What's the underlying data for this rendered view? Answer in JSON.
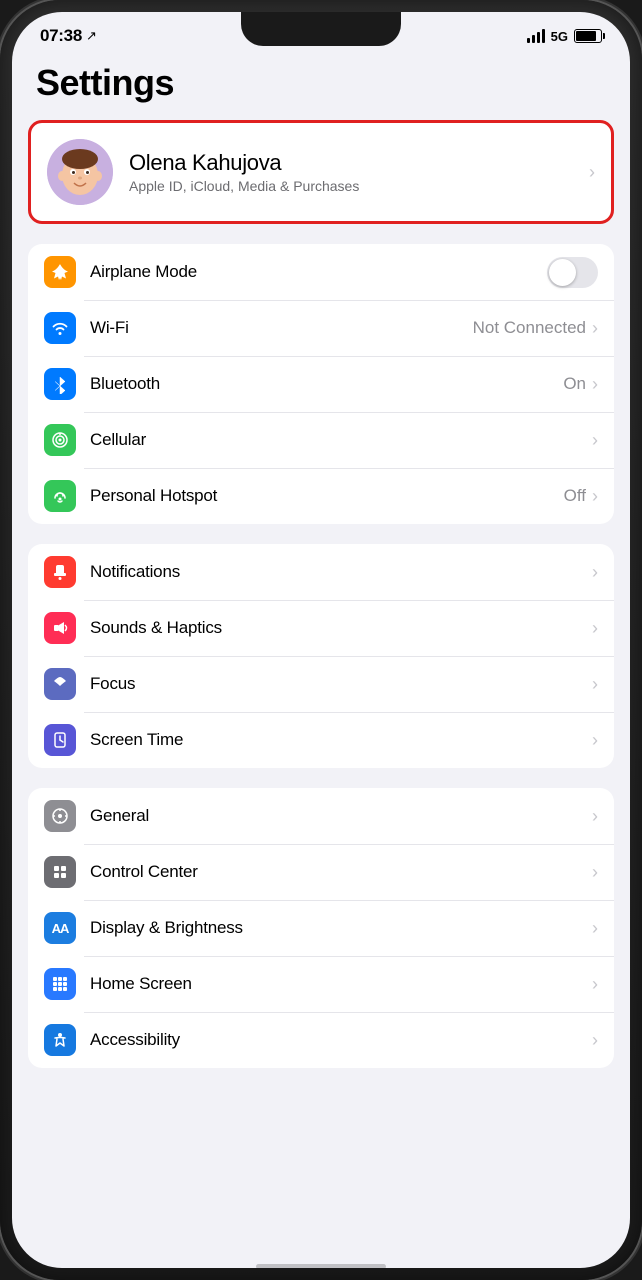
{
  "statusBar": {
    "time": "07:38",
    "signal5g": "5G"
  },
  "pageTitle": "Settings",
  "profile": {
    "name": "Olena Kahujova",
    "subtitle": "Apple ID, iCloud, Media & Purchases",
    "avatarEmoji": "🧑"
  },
  "groups": [
    {
      "id": "connectivity",
      "items": [
        {
          "id": "airplane-mode",
          "label": "Airplane Mode",
          "iconBg": "icon-orange",
          "iconEmoji": "✈",
          "type": "toggle",
          "toggleOn": false
        },
        {
          "id": "wifi",
          "label": "Wi-Fi",
          "iconBg": "icon-blue",
          "iconEmoji": "📶",
          "type": "value",
          "value": "Not Connected"
        },
        {
          "id": "bluetooth",
          "label": "Bluetooth",
          "iconBg": "icon-blue-dark",
          "iconEmoji": "🔷",
          "type": "value",
          "value": "On"
        },
        {
          "id": "cellular",
          "label": "Cellular",
          "iconBg": "icon-green",
          "iconEmoji": "📡",
          "type": "chevron"
        },
        {
          "id": "personal-hotspot",
          "label": "Personal Hotspot",
          "iconBg": "icon-green",
          "iconEmoji": "🔗",
          "type": "value",
          "value": "Off"
        }
      ]
    },
    {
      "id": "notifications",
      "items": [
        {
          "id": "notifications",
          "label": "Notifications",
          "iconBg": "icon-red",
          "iconEmoji": "🔔",
          "type": "chevron"
        },
        {
          "id": "sounds-haptics",
          "label": "Sounds & Haptics",
          "iconBg": "icon-pink",
          "iconEmoji": "🔊",
          "type": "chevron"
        },
        {
          "id": "focus",
          "label": "Focus",
          "iconBg": "icon-indigo",
          "iconEmoji": "🌙",
          "type": "chevron"
        },
        {
          "id": "screen-time",
          "label": "Screen Time",
          "iconBg": "icon-purple",
          "iconEmoji": "⌛",
          "type": "chevron"
        }
      ]
    },
    {
      "id": "display",
      "items": [
        {
          "id": "general",
          "label": "General",
          "iconBg": "icon-gray",
          "iconEmoji": "⚙",
          "type": "chevron"
        },
        {
          "id": "control-center",
          "label": "Control Center",
          "iconBg": "icon-gray2",
          "iconEmoji": "⊞",
          "type": "chevron"
        },
        {
          "id": "display-brightness",
          "label": "Display & Brightness",
          "iconBg": "icon-aa-blue",
          "iconEmoji": "AA",
          "type": "chevron"
        },
        {
          "id": "home-screen",
          "label": "Home Screen",
          "iconBg": "icon-homescreen",
          "iconEmoji": "⊞",
          "type": "chevron"
        },
        {
          "id": "accessibility",
          "label": "Accessibility",
          "iconBg": "icon-accessibility",
          "iconEmoji": "♿",
          "type": "chevron"
        }
      ]
    }
  ],
  "chevronChar": "›",
  "locationArrow": "↗"
}
